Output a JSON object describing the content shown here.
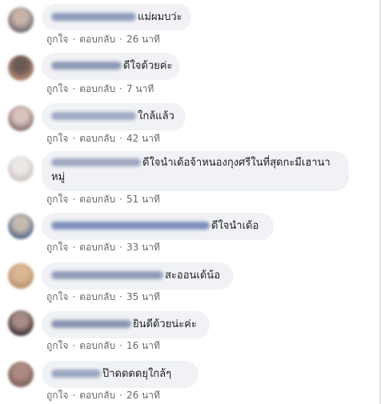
{
  "comments": [
    {
      "text": "แม่ผมบว่ะ",
      "like": "ถูกใจ",
      "reply": "ตอบกลับ",
      "time": "26 นาที",
      "avatar_colors": [
        "#6e6a72",
        "#c7b3a9"
      ],
      "name_color": "#8f9bbd"
    },
    {
      "text": "ดีใจด้วยค่ะ",
      "like": "ถูกใจ",
      "reply": "ตอบกลับ",
      "time": "7 นาที",
      "avatar_colors": [
        "#b98e78",
        "#6b5a55"
      ],
      "name_color": "#8d98b6"
    },
    {
      "text": "ใกล้แล้ว",
      "like": "ถูกใจ",
      "reply": "ตอบกลับ",
      "time": "42 นาที",
      "avatar_colors": [
        "#8b6f70",
        "#d9c1bd"
      ],
      "name_color": "#a0a9c4"
    },
    {
      "text": "ดีใจนำเด้อจ้าหนองกุงศรีในที่สุดกะมีเฮานาหมู่",
      "like": "ถูกใจ",
      "reply": "ตอบกลับ",
      "time": "51 นาที",
      "avatar_colors": [
        "#c9c3c0",
        "#ece8e6"
      ],
      "name_color": "#9ea7c0"
    },
    {
      "text": "ดีใจนำเด้อ",
      "like": "ถูกใจ",
      "reply": "ตอบกลับ",
      "time": "33 นาที",
      "avatar_colors": [
        "#4f6486",
        "#c5b9b0"
      ],
      "name_color": "#7c8fbc"
    },
    {
      "text": "สะออนเด้น้อ",
      "like": "ถูกใจ",
      "reply": "ตอบกลับ",
      "time": "35 นาที",
      "avatar_colors": [
        "#b88f6b",
        "#d9b792"
      ],
      "name_color": "#8e99b5"
    },
    {
      "text": "ยินดีด้วยน่ะค่ะ",
      "like": "ถูกใจ",
      "reply": "ตอบกลับ",
      "time": "16 นาที",
      "avatar_colors": [
        "#3b2f30",
        "#a88c88"
      ],
      "name_color": "#8b95b3"
    },
    {
      "text": "ป๊าดดดดยุใกล้ๆ",
      "like": "ถูกใจ",
      "reply": "ตอบกลับ",
      "time": "26 นาที",
      "avatar_colors": [
        "#7a6058",
        "#ac8a83"
      ],
      "name_color": "#99a4c0"
    }
  ]
}
